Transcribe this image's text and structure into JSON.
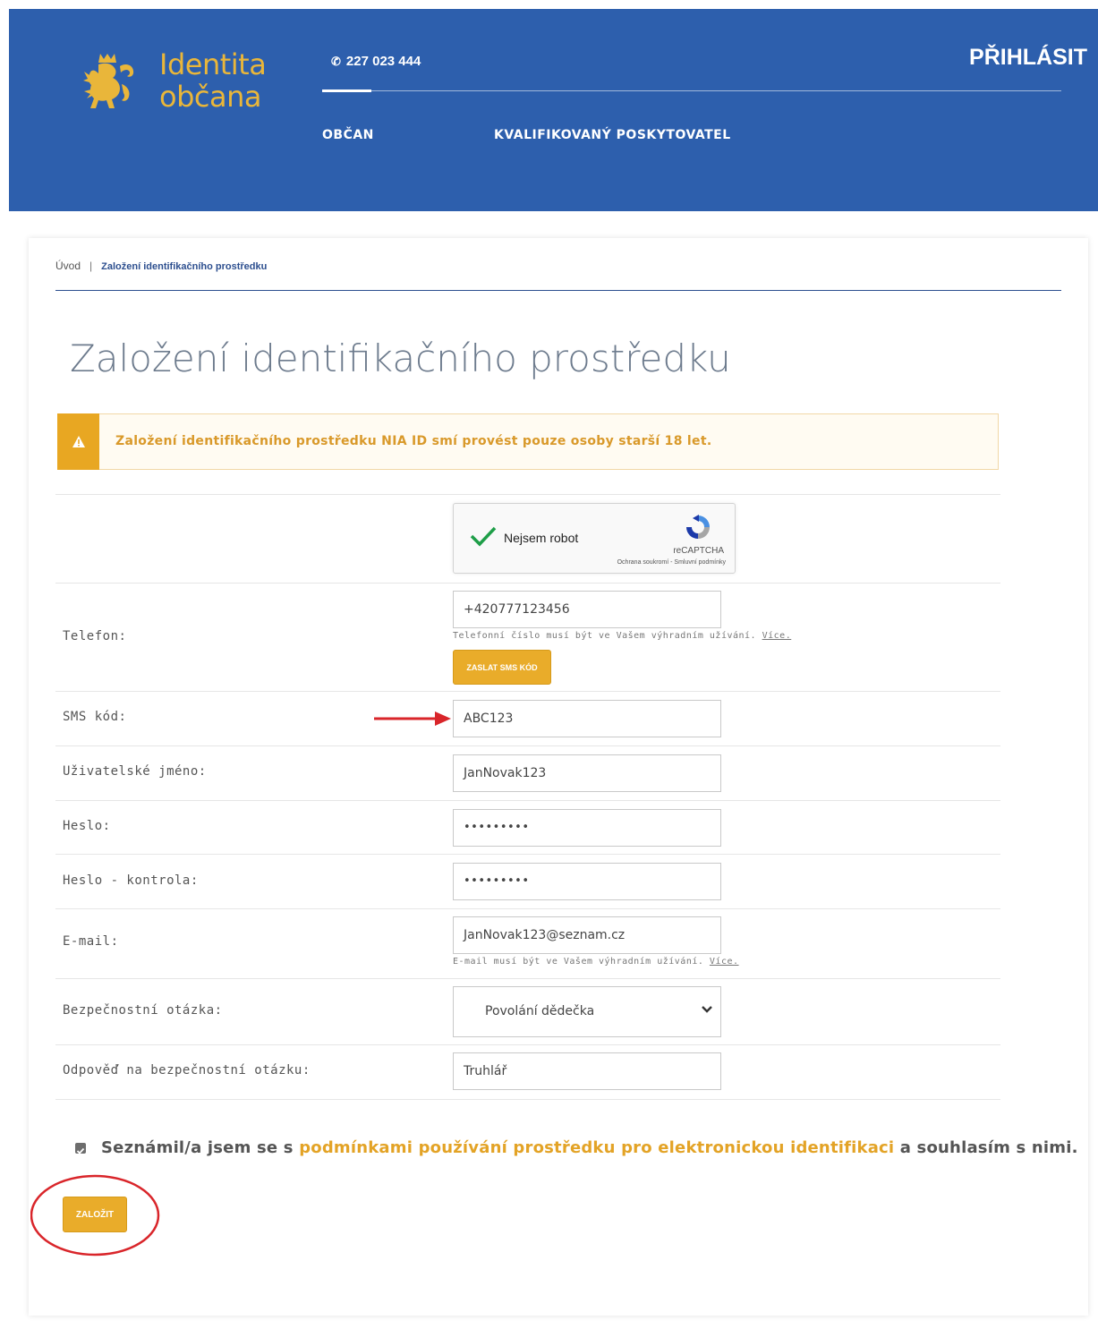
{
  "header": {
    "brand_line1": "Identita",
    "brand_line2": "občana",
    "phone": "227 023 444",
    "login_label": "PŘIHLÁSIT",
    "nav": [
      {
        "label": "OBČAN"
      },
      {
        "label": "KVALIFIKOVANÝ POSKYTOVATEL"
      }
    ]
  },
  "breadcrumb": {
    "home": "Úvod",
    "separator": "|",
    "current": "Založení identifikačního prostředku"
  },
  "page": {
    "title": "Založení identifikačního prostředku"
  },
  "alert": {
    "text": "Založení identifikačního prostředku NIA ID smí provést pouze osoby starší 18 let."
  },
  "captcha": {
    "label": "Nejsem robot",
    "brand": "reCAPTCHA",
    "links": "Ochrana soukromí - Smluvní podmínky"
  },
  "form": {
    "phone_label": "Telefon:",
    "phone_value": "+420777123456",
    "phone_hint": "Telefonní číslo musí být ve Vašem výhradním užívání.",
    "phone_hint_link": "Více.",
    "send_sms_label": "ZASLAT SMS KÓD",
    "sms_label": "SMS kód:",
    "sms_value": "ABC123",
    "username_label": "Uživatelské jméno:",
    "username_value": "JanNovak123",
    "password_label": "Heslo:",
    "password_value": "•••••••••",
    "password_check_label": "Heslo - kontrola:",
    "password_check_value": "•••••••••",
    "email_label": "E-mail:",
    "email_value": "JanNovak123@seznam.cz",
    "email_hint": "E-mail musí být ve Vašem výhradním užívání.",
    "email_hint_link": "Více.",
    "question_label": "Bezpečnostní otázka:",
    "question_value": "Povolání dědečka",
    "answer_label": "Odpověď na bezpečnostní otázku:",
    "answer_value": "Truhlář"
  },
  "agree": {
    "prefix": "Seznámil/a jsem se s ",
    "link": "podmínkami používání prostředku pro elektronickou identifikaci",
    "suffix": " a souhlasím s nimi.",
    "checked": true
  },
  "submit_label": "ZALOŽIT",
  "colors": {
    "header_bg": "#2d5fad",
    "accent": "#e9ac2a",
    "annotation": "#d9252a"
  }
}
